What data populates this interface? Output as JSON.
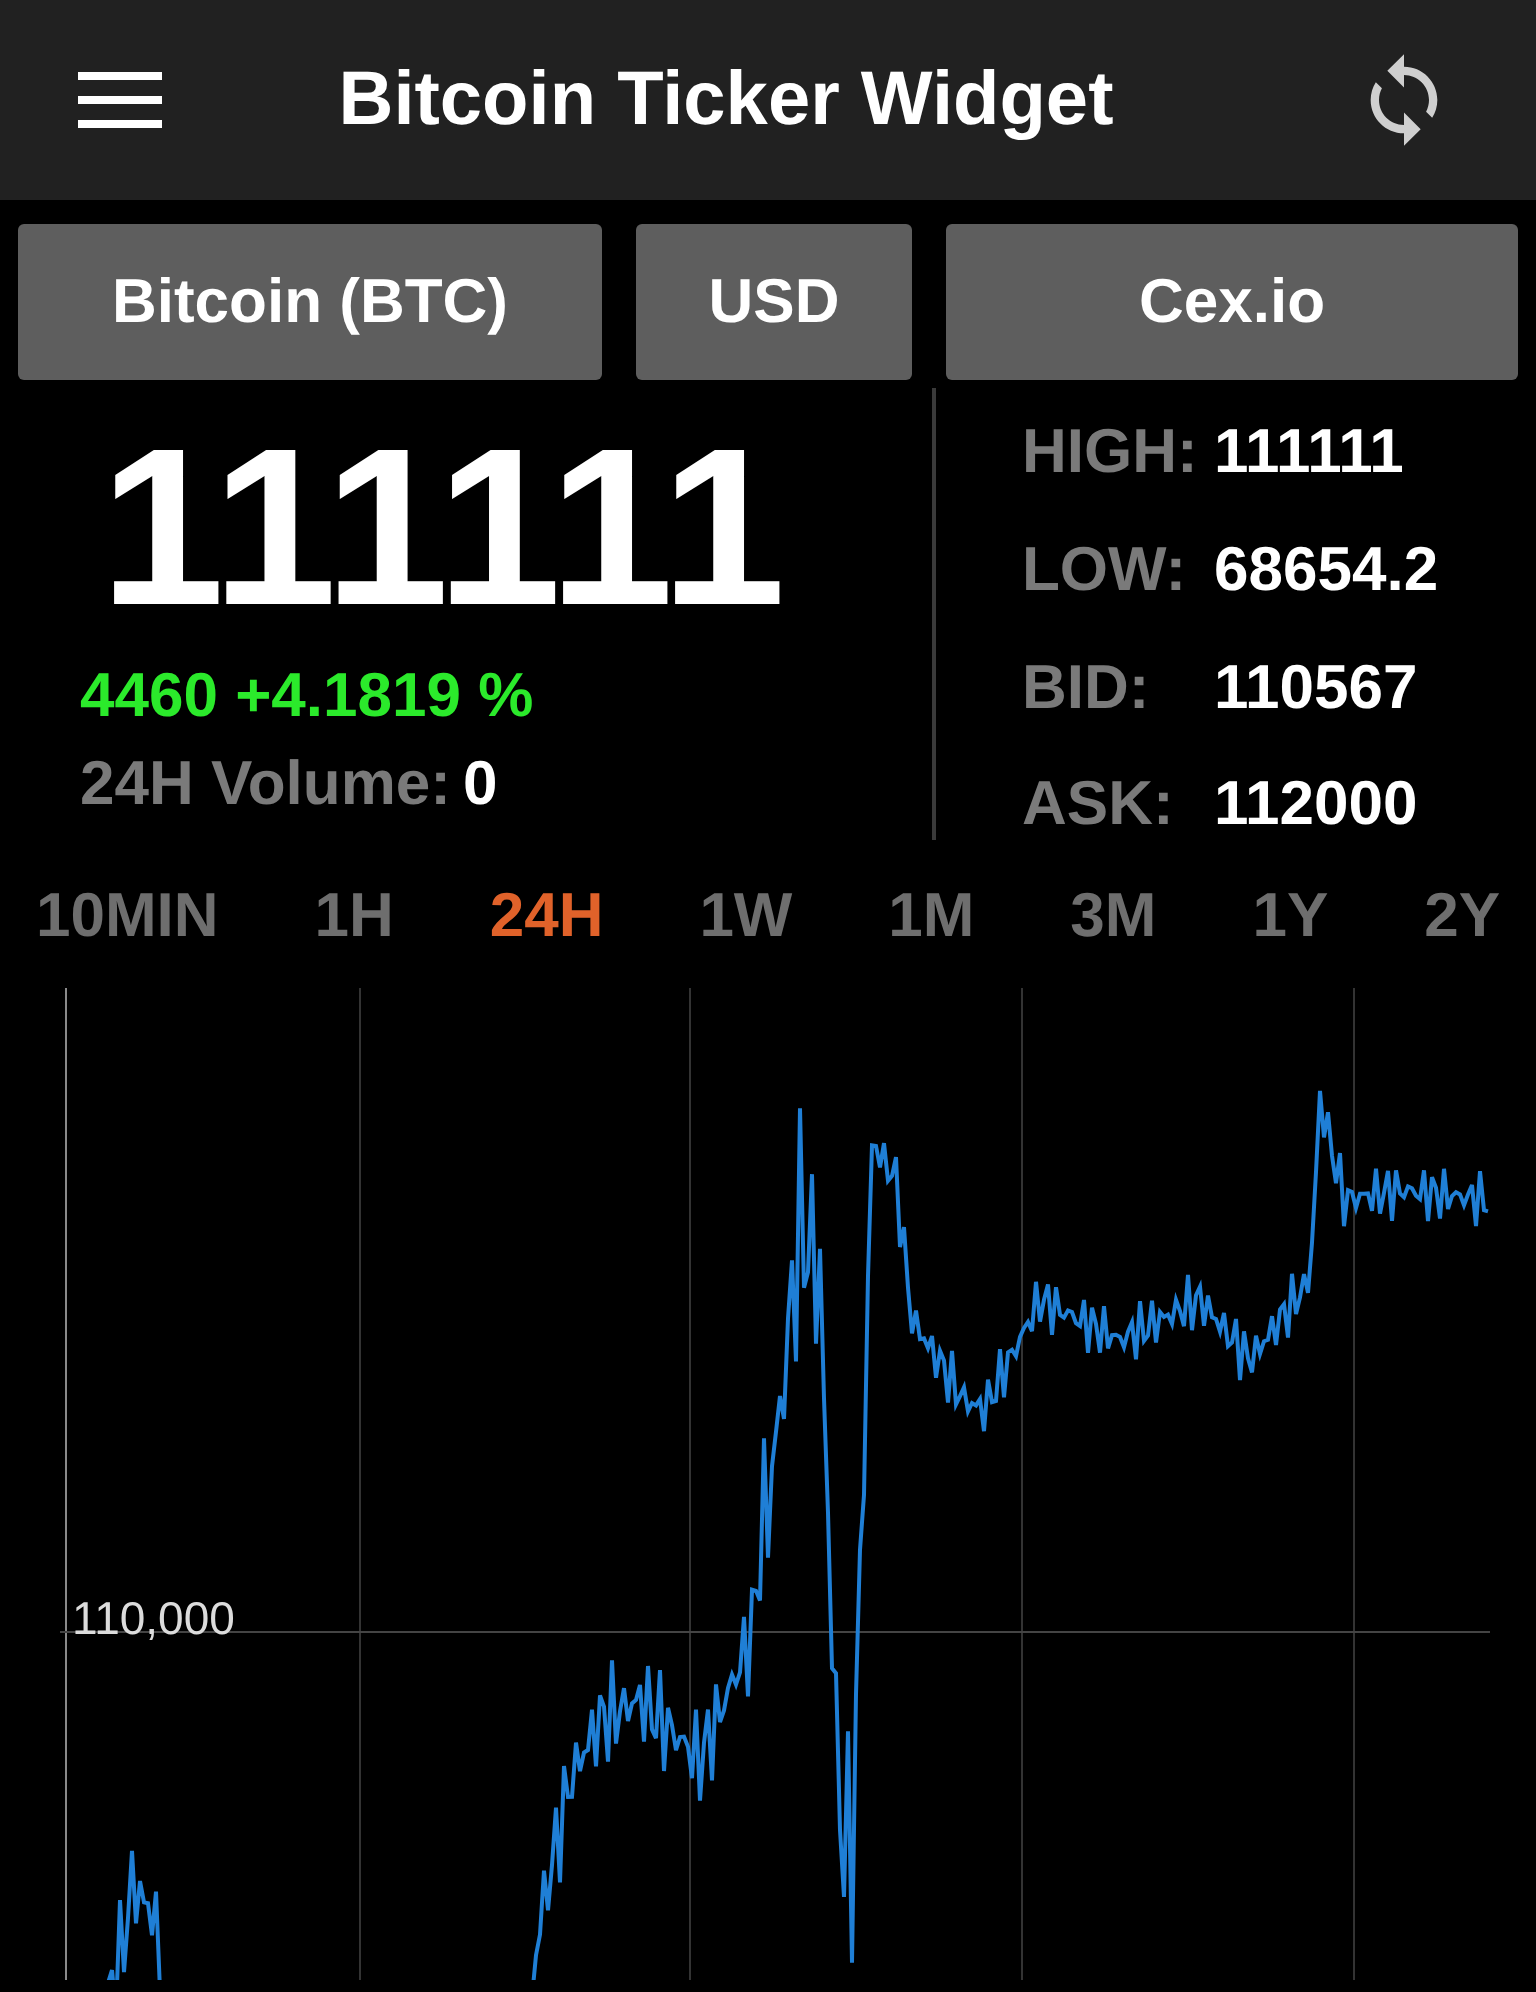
{
  "app_bar": {
    "title": "Bitcoin Ticker Widget"
  },
  "selectors": [
    {
      "label": "Bitcoin (BTC)"
    },
    {
      "label": "USD"
    },
    {
      "label": "Cex.io"
    }
  ],
  "price": "111111",
  "change": "4460 +4.1819 %",
  "volume": {
    "label": "24H Volume:",
    "value": "0"
  },
  "stats": [
    {
      "label": "HIGH:",
      "value": "111111"
    },
    {
      "label": "LOW:",
      "value": "68654.2"
    },
    {
      "label": "BID:",
      "value": "110567"
    },
    {
      "label": "ASK:",
      "value": "112000"
    }
  ],
  "timeframes": [
    {
      "label": "10MIN",
      "selected": false
    },
    {
      "label": "1H",
      "selected": false
    },
    {
      "label": "24H",
      "selected": true
    },
    {
      "label": "1W",
      "selected": false
    },
    {
      "label": "1M",
      "selected": false
    },
    {
      "label": "3M",
      "selected": false
    },
    {
      "label": "1Y",
      "selected": false
    },
    {
      "label": "2Y",
      "selected": false
    }
  ],
  "chart": {
    "y_tick_label": "110,000"
  }
}
